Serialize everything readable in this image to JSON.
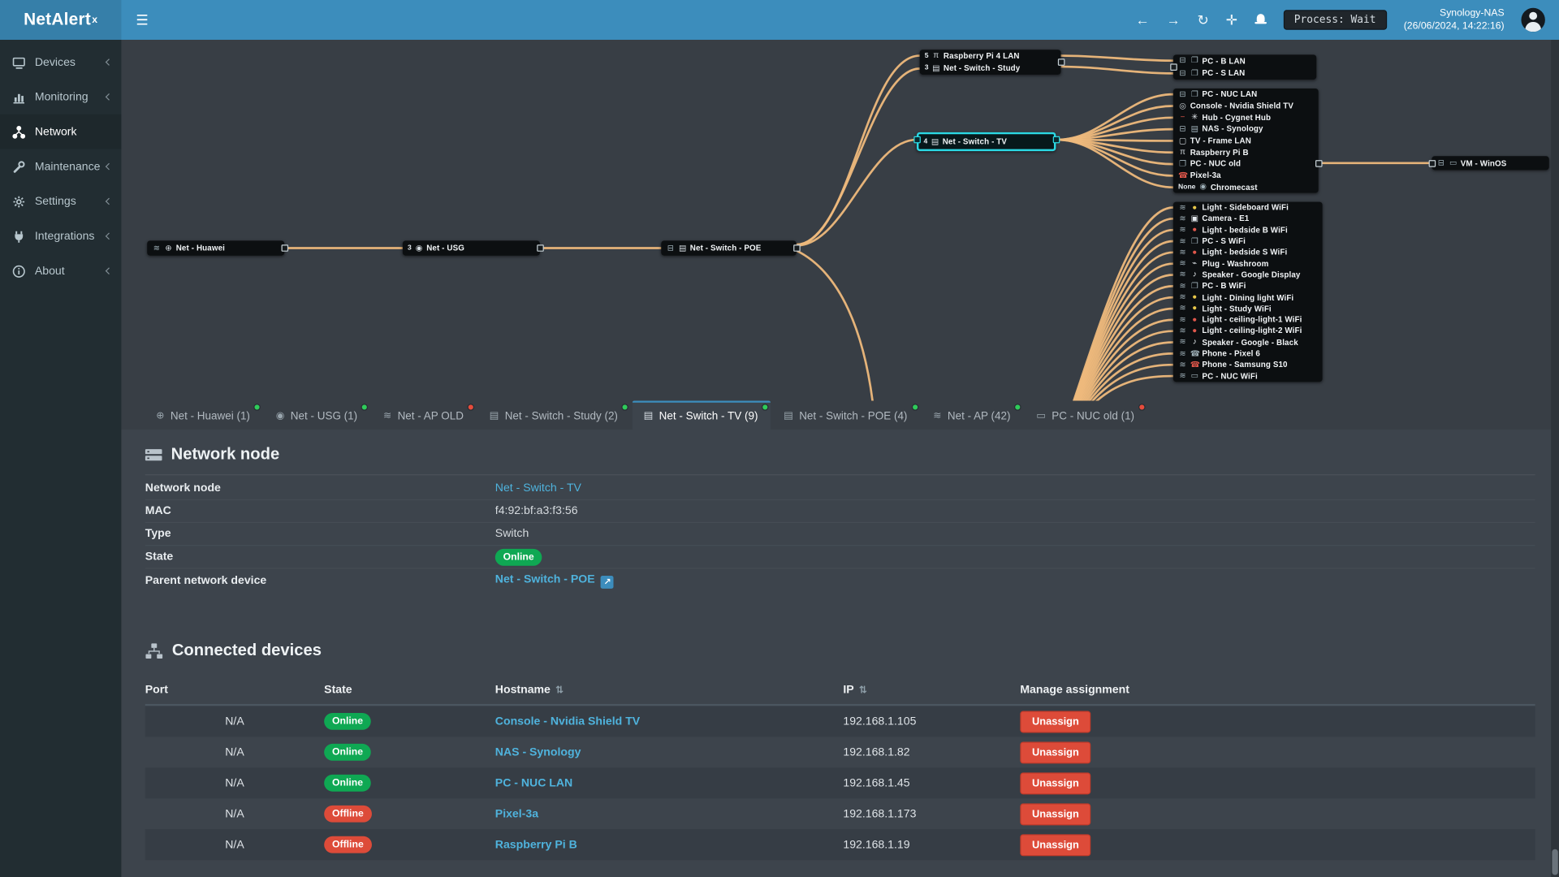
{
  "topbar": {
    "brand": "NetAlert",
    "brand_sup": "x",
    "process_badge": "Process: Wait",
    "host_name": "Synology-NAS",
    "host_time": "(26/06/2024, 14:22:16)"
  },
  "sidebar": {
    "items": [
      {
        "label": "Devices",
        "icon": "devices",
        "chevron": true,
        "active": false
      },
      {
        "label": "Monitoring",
        "icon": "monitoring",
        "chevron": true,
        "active": false
      },
      {
        "label": "Network",
        "icon": "network",
        "chevron": false,
        "active": true
      },
      {
        "label": "Maintenance",
        "icon": "maintenance",
        "chevron": true,
        "active": false
      },
      {
        "label": "Settings",
        "icon": "settings",
        "chevron": true,
        "active": false
      },
      {
        "label": "Integrations",
        "icon": "integrations",
        "chevron": true,
        "active": false
      },
      {
        "label": "About",
        "icon": "about",
        "chevron": true,
        "active": false
      }
    ]
  },
  "diagram": {
    "nodes": {
      "huawei": {
        "rows": [
          {
            "icons": [
              "wifi",
              "globe"
            ],
            "label": "Net - Huawei"
          }
        ]
      },
      "usg": {
        "rows": [
          {
            "port": "3",
            "icons": [
              "pin"
            ],
            "label": "Net - USG"
          }
        ]
      },
      "poe": {
        "rows": [
          {
            "icons": [
              "eth",
              "switch"
            ],
            "label": "Net - Switch - POE"
          }
        ]
      },
      "study": {
        "rows": [
          {
            "port": "5",
            "icons": [
              "pi"
            ],
            "label": "Raspberry Pi 4 LAN"
          },
          {
            "port": "3",
            "icons": [
              "switch"
            ],
            "label": "Net - Switch - Study"
          }
        ]
      },
      "tv": {
        "selected": true,
        "rows": [
          {
            "port": "4",
            "icons": [
              "switch"
            ],
            "label": "Net - Switch - TV"
          }
        ]
      },
      "tv_children": {
        "rows": [
          {
            "icons": [
              "eth",
              "monitors"
            ],
            "label": "PC - NUC LAN"
          },
          {
            "icons": [
              "console"
            ],
            "label": "Console - Nvidia Shield TV"
          },
          {
            "icons": [
              "dash-red",
              "hub"
            ],
            "label": "Hub - Cygnet Hub"
          },
          {
            "icons": [
              "eth",
              "nas"
            ],
            "label": "NAS - Synology"
          },
          {
            "icons": [
              "tv"
            ],
            "label": "TV - Frame LAN"
          },
          {
            "icons": [
              "pi"
            ],
            "label": "Raspberry Pi B"
          },
          {
            "icons": [
              "monitors"
            ],
            "label": "PC - NUC old"
          },
          {
            "icons": [
              "phone-red"
            ],
            "label": "Pixel-3a"
          },
          {
            "port": "None",
            "icons": [
              "cast"
            ],
            "label": "Chromecast"
          }
        ]
      },
      "pc_lan": {
        "rows": [
          {
            "icons": [
              "eth",
              "monitors"
            ],
            "label": "PC - B LAN"
          },
          {
            "icons": [
              "eth",
              "monitors"
            ],
            "label": "PC - S LAN"
          }
        ]
      },
      "wifi_group": {
        "rows": [
          {
            "icons": [
              "wifi",
              "bulb-yellow"
            ],
            "label": "Light - Sideboard WiFi"
          },
          {
            "icons": [
              "wifi",
              "camera"
            ],
            "label": "Camera - E1"
          },
          {
            "icons": [
              "wifi",
              "bulb-red"
            ],
            "label": "Light - bedside B WiFi"
          },
          {
            "icons": [
              "wifi",
              "monitors"
            ],
            "label": "PC - S WiFi"
          },
          {
            "icons": [
              "wifi",
              "bulb-red"
            ],
            "label": "Light - bedside S WiFi"
          },
          {
            "icons": [
              "wifi",
              "plug"
            ],
            "label": "Plug - Washroom"
          },
          {
            "icons": [
              "wifi",
              "speaker"
            ],
            "label": "Speaker - Google Display"
          },
          {
            "icons": [
              "wifi",
              "monitors"
            ],
            "label": "PC - B WiFi"
          },
          {
            "icons": [
              "wifi",
              "bulb-yellow"
            ],
            "label": "Light - Dining light WiFi"
          },
          {
            "icons": [
              "wifi",
              "bulb-yellow"
            ],
            "label": "Light - Study WiFi"
          },
          {
            "icons": [
              "wifi",
              "bulb-red"
            ],
            "label": "Light - ceiling-light-1 WiFi"
          },
          {
            "icons": [
              "wifi",
              "bulb-red"
            ],
            "label": "Light - ceiling-light-2 WiFi"
          },
          {
            "icons": [
              "wifi",
              "speaker"
            ],
            "label": "Speaker - Google - Black"
          },
          {
            "icons": [
              "wifi",
              "phone"
            ],
            "label": "Phone - Pixel 6"
          },
          {
            "icons": [
              "wifi",
              "phone-red"
            ],
            "label": "Phone - Samsung S10"
          },
          {
            "icons": [
              "wifi",
              "monitor"
            ],
            "label": "PC - NUC WiFi"
          }
        ]
      },
      "vm": {
        "rows": [
          {
            "icons": [
              "eth",
              "monitor"
            ],
            "label": "VM - WinOS"
          }
        ]
      }
    }
  },
  "tabs": [
    {
      "label": "Net - Huawei (1)",
      "icon": "globe",
      "dot": "green",
      "active": false
    },
    {
      "label": "Net - USG (1)",
      "icon": "pin",
      "dot": "green",
      "active": false
    },
    {
      "label": "Net - AP OLD",
      "icon": "wifi",
      "dot": "red",
      "active": false
    },
    {
      "label": "Net - Switch - Study (2)",
      "icon": "switch",
      "dot": "green",
      "active": false
    },
    {
      "label": "Net - Switch - TV (9)",
      "icon": "switch",
      "dot": "green",
      "active": true
    },
    {
      "label": "Net - Switch - POE (4)",
      "icon": "switch",
      "dot": "green",
      "active": false
    },
    {
      "label": "Net - AP (42)",
      "icon": "wifi",
      "dot": "green",
      "active": false
    },
    {
      "label": "PC - NUC old (1)",
      "icon": "pc",
      "dot": "red",
      "active": false
    }
  ],
  "node_panel": {
    "title": "Network node",
    "fields": [
      {
        "label": "Network node",
        "value": "Net - Switch - TV",
        "kind": "link"
      },
      {
        "label": "MAC",
        "value": "f4:92:bf:a3:f3:56",
        "kind": "text"
      },
      {
        "label": "Type",
        "value": "Switch",
        "kind": "text"
      },
      {
        "label": "State",
        "value": "Online",
        "kind": "badge-online"
      },
      {
        "label": "Parent network device",
        "value": "Net - Switch - POE",
        "kind": "link-ext"
      }
    ]
  },
  "devices_panel": {
    "title": "Connected devices",
    "columns": {
      "port": "Port",
      "state": "State",
      "hostname": "Hostname",
      "ip": "IP",
      "manage": "Manage assignment"
    },
    "unassign_label": "Unassign",
    "rows": [
      {
        "port": "N/A",
        "state": "Online",
        "hostname": "Console - Nvidia Shield TV",
        "ip": "192.168.1.105"
      },
      {
        "port": "N/A",
        "state": "Online",
        "hostname": "NAS - Synology",
        "ip": "192.168.1.82"
      },
      {
        "port": "N/A",
        "state": "Online",
        "hostname": "PC - NUC LAN",
        "ip": "192.168.1.45"
      },
      {
        "port": "N/A",
        "state": "Offline",
        "hostname": "Pixel-3a",
        "ip": "192.168.1.173"
      },
      {
        "port": "N/A",
        "state": "Offline",
        "hostname": "Raspberry Pi B",
        "ip": "192.168.1.19"
      }
    ]
  },
  "colors": {
    "accent": "#3c8dbc",
    "online": "#0fa853",
    "offline": "#dd4b39",
    "link": "#4fb3dd",
    "tree_link": "#eeb97c",
    "selected_node": "#2bd9e4"
  }
}
